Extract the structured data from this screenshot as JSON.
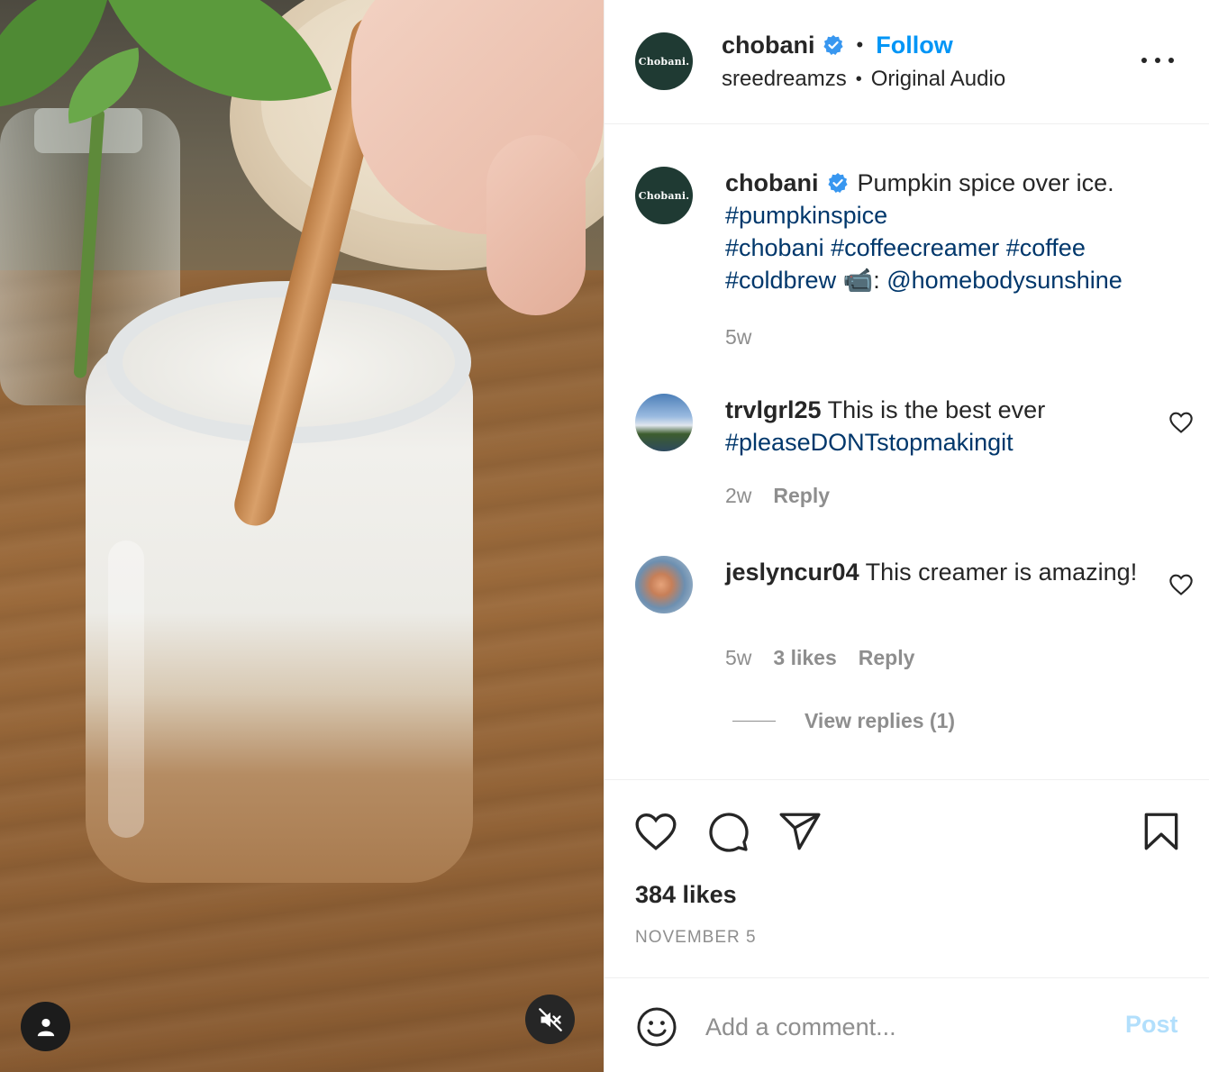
{
  "media": {
    "user_tag_icon": "person-icon",
    "mute_icon": "speaker-muted-icon"
  },
  "header": {
    "avatar_text": "Chobani.",
    "username": "chobani",
    "separator": "•",
    "follow_label": "Follow",
    "audio_user": "sreedreamzs",
    "audio_separator": "•",
    "audio_label": "Original Audio",
    "more_icon": "more-horizontal-icon"
  },
  "caption": {
    "avatar_text": "Chobani.",
    "username": "chobani",
    "text": "Pumpkin spice over ice.",
    "hashtag1": "#pumpkinspice",
    "hashtag2": "#chobani",
    "hashtag3": "#coffeecreamer",
    "hashtag4": "#coffee",
    "hashtag5": "#coldbrew",
    "camera_emoji": "📹",
    "credit_sep": ":",
    "mention": "@homebodysunshine",
    "time": "5w"
  },
  "comments": [
    {
      "username": "trvlgrl25",
      "text": "This is the best ever",
      "hashtag": "#pleaseDONTstopmakingit",
      "time": "2w",
      "reply_label": "Reply"
    },
    {
      "username": "jeslyncur04",
      "text": "This creamer is amazing!",
      "time": "5w",
      "likes": "3 likes",
      "reply_label": "Reply",
      "view_replies": "View replies (1)"
    }
  ],
  "actions": {
    "like_icon": "heart-icon",
    "comment_icon": "comment-icon",
    "share_icon": "paper-plane-icon",
    "save_icon": "bookmark-icon",
    "likes": "384 likes",
    "date": "NOVEMBER 5"
  },
  "comment_bar": {
    "emoji_icon": "smiley-icon",
    "placeholder": "Add a comment...",
    "post_label": "Post"
  },
  "colors": {
    "accent": "#0095f6",
    "hashtag": "#00376b",
    "muted": "#8e8e8e",
    "post_disabled": "#b2dffc",
    "brand_avatar": "#1f3a33"
  }
}
